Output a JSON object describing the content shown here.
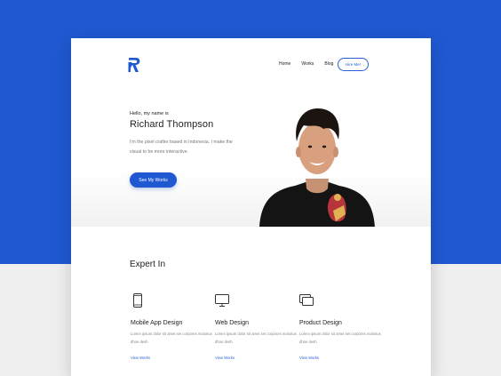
{
  "colors": {
    "accent": "#1f58d0",
    "background_top": "#1f58d0",
    "background_bottom": "#efefef",
    "text_dark": "#222222",
    "text_muted": "#777777"
  },
  "logo": {
    "icon": "r-logo-icon"
  },
  "nav": {
    "items": [
      "Home",
      "Works",
      "Blog"
    ],
    "hire_button": "Hire Me!"
  },
  "hero": {
    "greeting": "Hello, my name is",
    "name": "Richard Thompson",
    "description": "I'm the pixel crafter based in Indonesia. I make the visual to be more interactive.",
    "cta_label": "See My Works"
  },
  "expert": {
    "title": "Expert In",
    "services": [
      {
        "icon": "mobile-icon",
        "title": "Mobile App Design",
        "description": "Lorem ipsum dolor sit amet set corpores molorius dhoe desh",
        "link": "View Works"
      },
      {
        "icon": "monitor-icon",
        "title": "Web Design",
        "description": "Lorem ipsum dolor sit amet set corpores molorius dhoe desh",
        "link": "View Works"
      },
      {
        "icon": "layers-icon",
        "title": "Product Design",
        "description": "Lorem ipsum dolor sit amet set corpores molorius dhoe desh",
        "link": "View Works"
      }
    ]
  }
}
